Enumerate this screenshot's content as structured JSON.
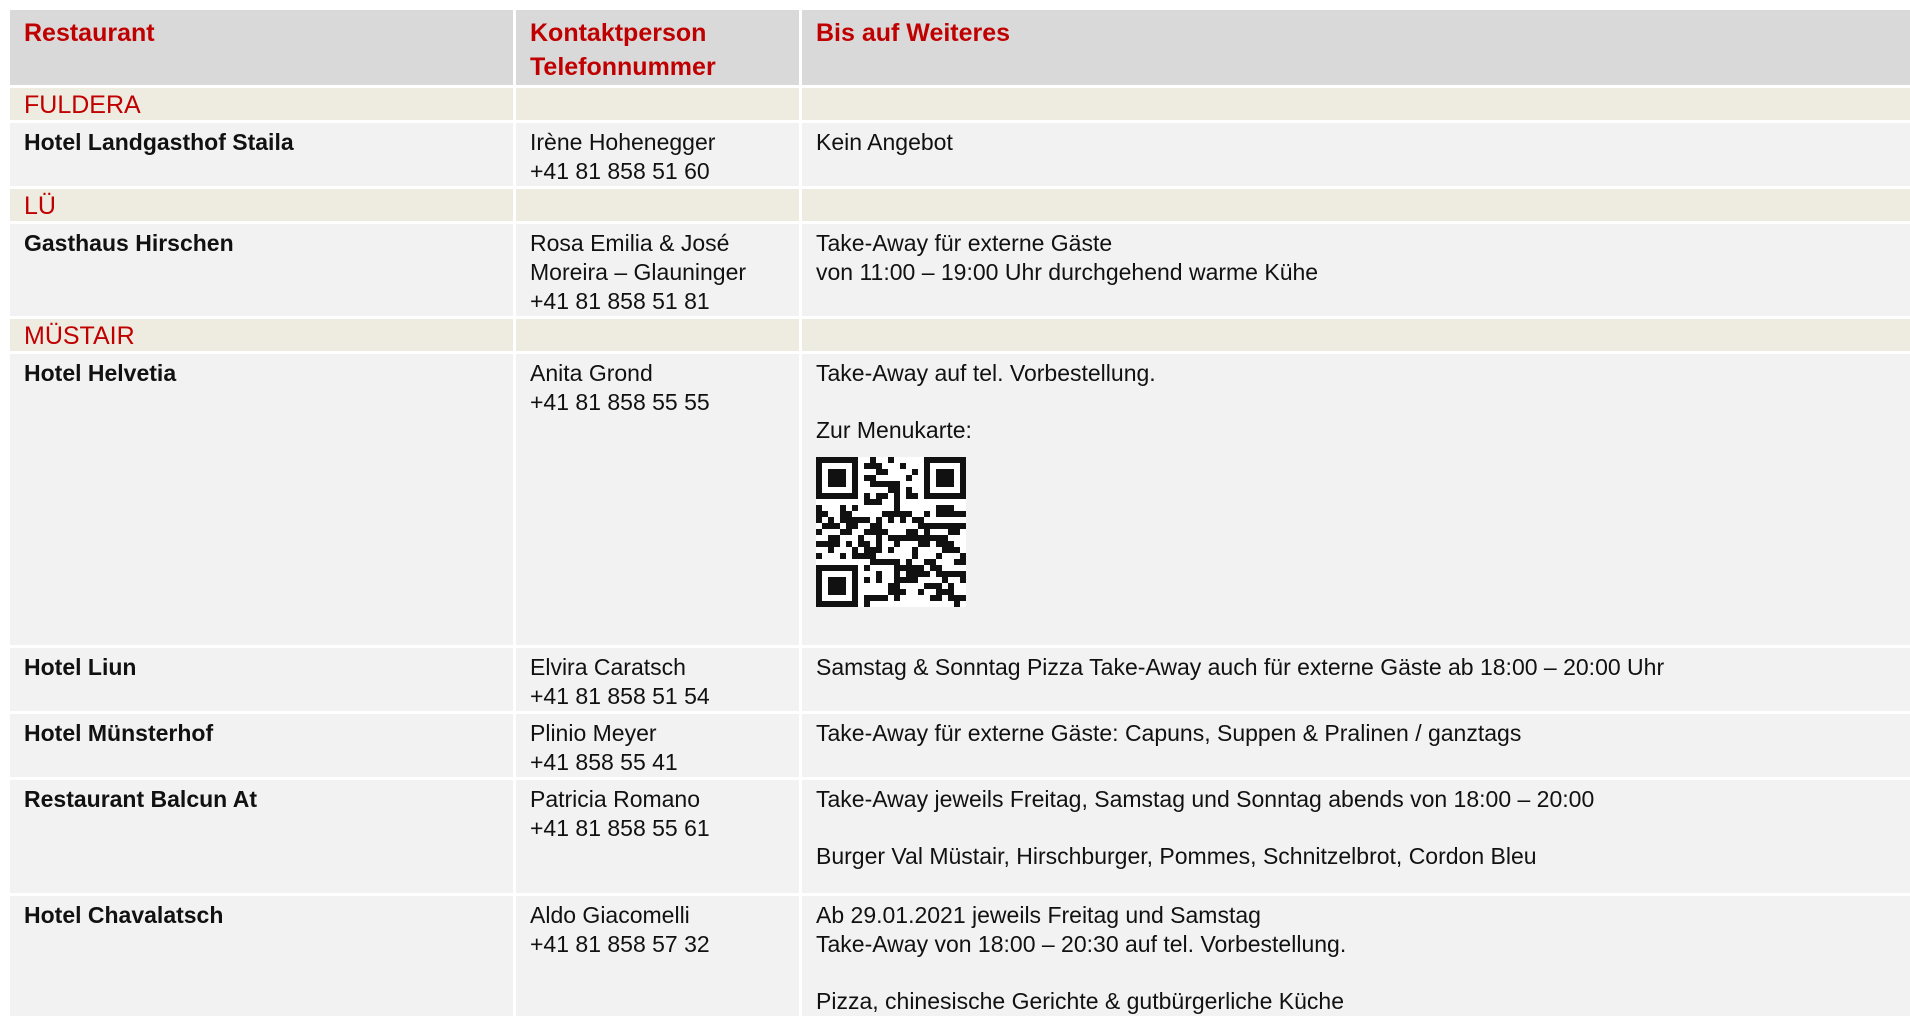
{
  "header": {
    "restaurant": "Restaurant",
    "contact_line1": "Kontaktperson",
    "contact_line2": "Telefonnummer",
    "offer": "Bis auf Weiteres"
  },
  "sections": [
    {
      "name": "FULDERA",
      "rows": [
        {
          "name": "Hotel Landgasthof Staila",
          "contact": [
            "Irène Hohenegger",
            "+41 81 858 51 60"
          ],
          "offer": [
            "Kein Angebot"
          ]
        }
      ]
    },
    {
      "name": "LÜ",
      "rows": [
        {
          "name": "Gasthaus Hirschen",
          "contact": [
            "Rosa Emilia & José",
            "Moreira – Glauninger",
            "+41 81 858 51 81"
          ],
          "offer": [
            "Take-Away für externe Gäste",
            "von 11:00 – 19:00 Uhr durchgehend warme Kühe"
          ]
        }
      ]
    },
    {
      "name": "MÜSTAIR",
      "rows": [
        {
          "name": "Hotel Helvetia",
          "contact": [
            "Anita Grond",
            "+41 81 858 55 55"
          ],
          "offer": [
            "Take-Away auf tel. Vorbestellung.",
            "",
            "Zur Menukarte:"
          ],
          "qr_icon": "qr-code-icon"
        },
        {
          "name": "Hotel Liun",
          "contact": [
            "Elvira Caratsch",
            "+41 81 858 51 54"
          ],
          "offer": [
            "Samstag & Sonntag Pizza Take-Away auch für externe Gäste ab 18:00 – 20:00 Uhr"
          ]
        },
        {
          "name": "Hotel Münsterhof",
          "contact": [
            "Plinio Meyer",
            "+41 858 55 41"
          ],
          "offer": [
            "Take-Away für externe Gäste: Capuns, Suppen & Pralinen / ganztags"
          ]
        },
        {
          "name": "Restaurant Balcun At",
          "contact": [
            "Patricia Romano",
            "+41 81 858 55 61"
          ],
          "offer": [
            "Take-Away jeweils Freitag, Samstag und Sonntag abends von 18:00 – 20:00",
            "",
            "Burger Val Müstair, Hirschburger, Pommes, Schnitzelbrot, Cordon Bleu"
          ]
        },
        {
          "name": "Hotel Chavalatsch",
          "contact": [
            "Aldo Giacomelli",
            "+41 81 858 57 32"
          ],
          "offer": [
            "Ab 29.01.2021 jeweils Freitag und Samstag",
            "Take-Away von 18:00 – 20:30 auf tel. Vorbestellung.",
            "",
            "Pizza, chinesische Gerichte & gutbürgerliche Küche"
          ]
        }
      ]
    }
  ],
  "colors": {
    "header_bg": "#d9d9d9",
    "section_bg": "#eeece1",
    "row_bg": "#f2f2f2",
    "accent_red": "#c00000"
  }
}
